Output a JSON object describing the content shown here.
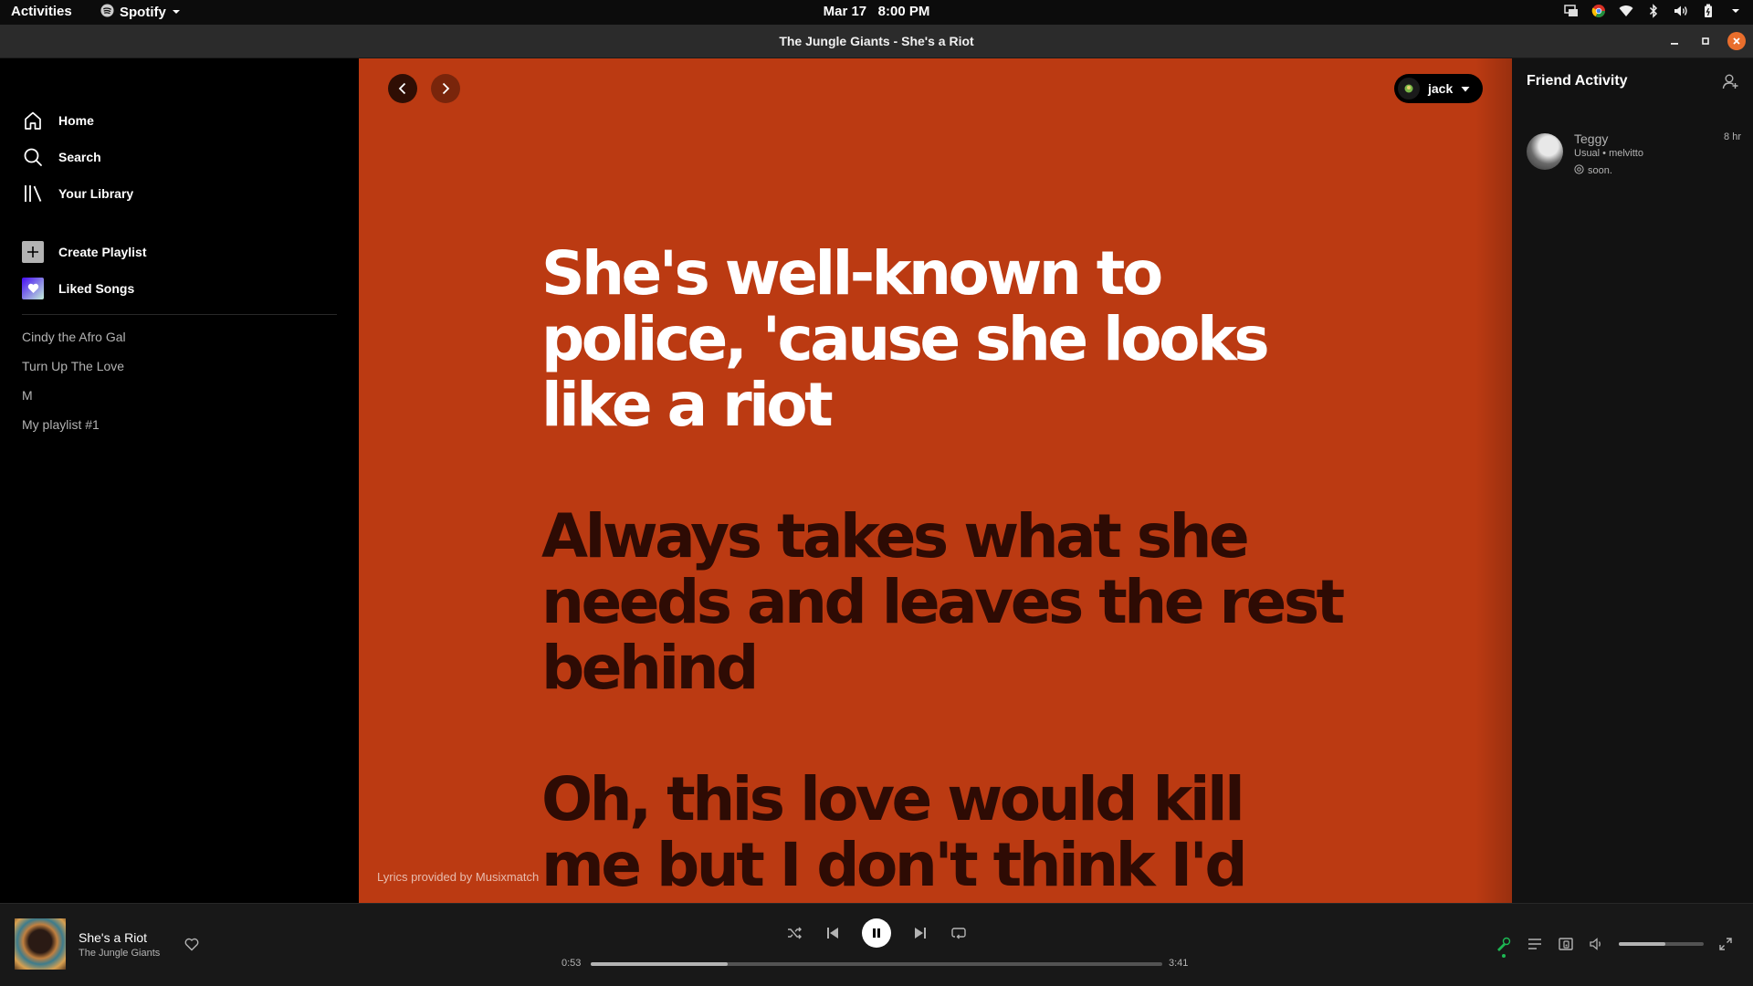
{
  "topbar": {
    "activities": "Activities",
    "app_name": "Spotify",
    "date": "Mar 17",
    "time": "8:00 PM"
  },
  "window": {
    "title": "The Jungle Giants - She's a Riot"
  },
  "sidebar": {
    "nav": [
      {
        "label": "Home",
        "icon": "home-icon"
      },
      {
        "label": "Search",
        "icon": "search-icon"
      },
      {
        "label": "Your Library",
        "icon": "library-icon"
      }
    ],
    "create_playlist": "Create Playlist",
    "liked_songs": "Liked Songs",
    "playlists": [
      "Cindy the Afro Gal",
      "Turn Up The Love",
      "M",
      "My playlist #1"
    ]
  },
  "header": {
    "user_name": "jack"
  },
  "lyrics": {
    "lines": [
      "She's well-known to police, 'cause she looks like a riot",
      "Always takes what she needs and leaves the rest behind",
      "Oh, this love would kill me but I don't think I'd mind"
    ],
    "active_index": 0,
    "credit": "Lyrics provided by Musixmatch"
  },
  "friend_activity": {
    "title": "Friend Activity",
    "friends": [
      {
        "name": "Teggy",
        "time": "8 hr",
        "track": "Usual • melvitto",
        "context": "soon."
      }
    ]
  },
  "player": {
    "track_title": "She's a Riot",
    "artist": "The Jungle Giants",
    "elapsed": "0:53",
    "duration": "3:41",
    "progress": 0.24,
    "volume": 0.55
  },
  "colors": {
    "lyrics_background": "#bb3a12",
    "active_lyric": "#ffffff",
    "upcoming_lyric": "#2e0b04",
    "accent_green": "#1db954"
  }
}
